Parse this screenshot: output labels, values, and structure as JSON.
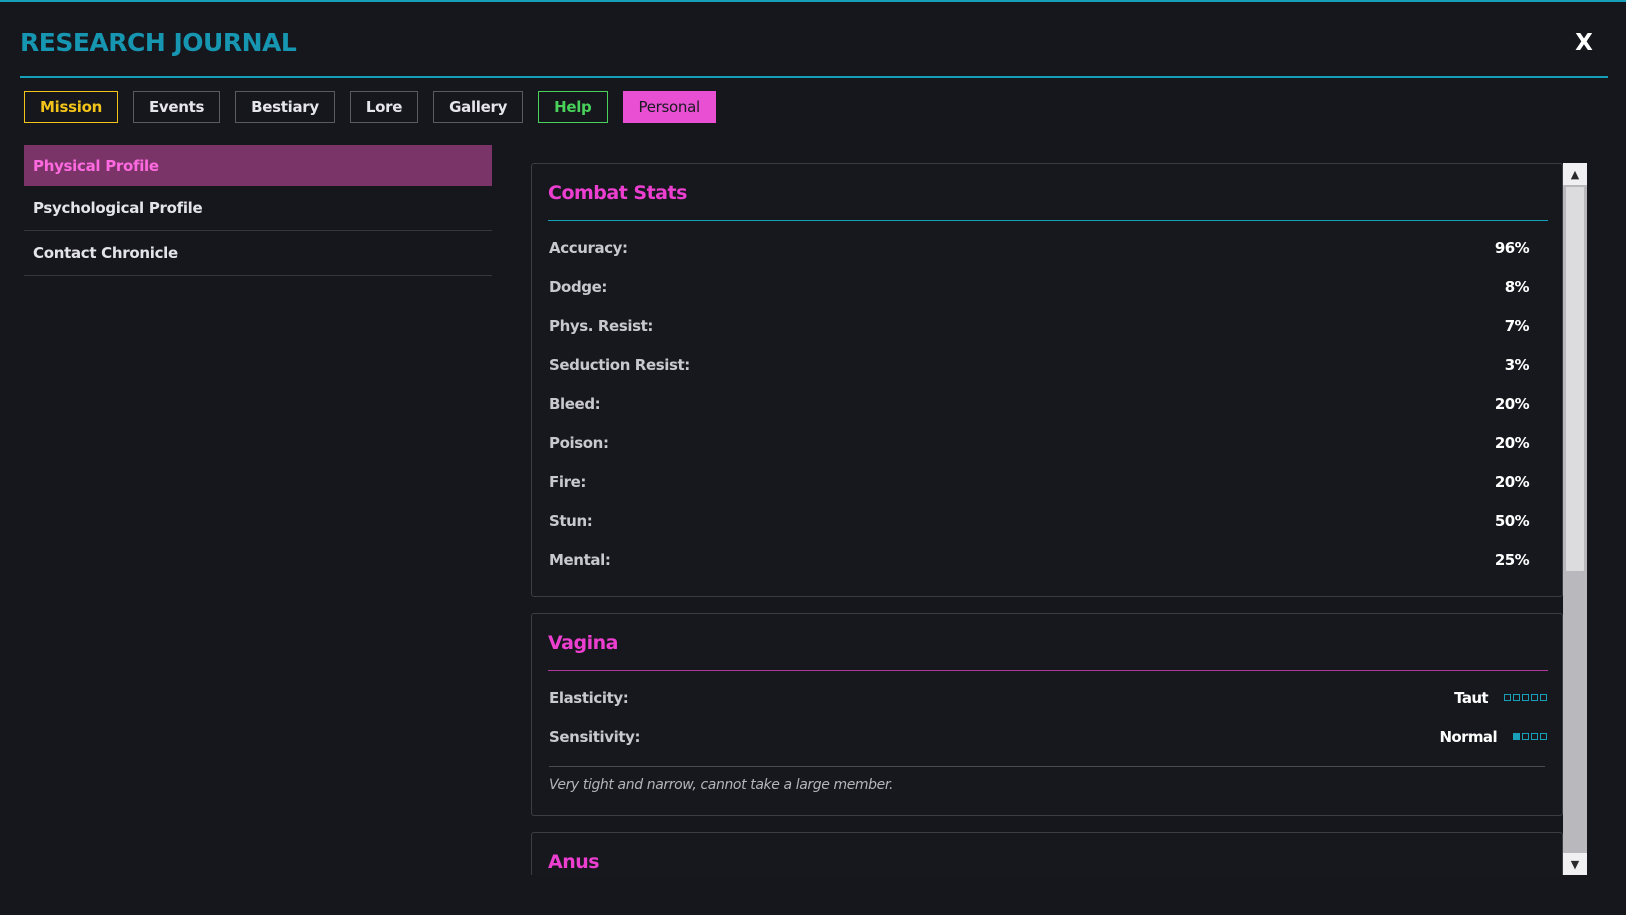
{
  "header": {
    "title": "RESEARCH JOURNAL",
    "close_label": "X"
  },
  "tabs": [
    {
      "label": "Mission",
      "color": "#f2c318"
    },
    {
      "label": "Events"
    },
    {
      "label": "Bestiary"
    },
    {
      "label": "Lore"
    },
    {
      "label": "Gallery"
    },
    {
      "label": "Help",
      "color": "#49d25a"
    },
    {
      "label": "Personal",
      "color": "#e84fd2",
      "active": true
    }
  ],
  "sidebar": {
    "items": [
      {
        "label": "Physical Profile",
        "active": true
      },
      {
        "label": "Psychological Profile"
      },
      {
        "label": "Contact Chronicle"
      }
    ]
  },
  "combat": {
    "title": "Combat Stats",
    "stats": [
      {
        "label": "Accuracy:",
        "value": "96%"
      },
      {
        "label": "Dodge:",
        "value": "8%"
      },
      {
        "label": "Phys. Resist:",
        "value": "7%"
      },
      {
        "label": "Seduction Resist:",
        "value": "3%"
      },
      {
        "label": "Bleed:",
        "value": "20%"
      },
      {
        "label": "Poison:",
        "value": "20%"
      },
      {
        "label": "Fire:",
        "value": "20%"
      },
      {
        "label": "Stun:",
        "value": "50%"
      },
      {
        "label": "Mental:",
        "value": "25%"
      }
    ]
  },
  "vagina": {
    "title": "Vagina",
    "attributes": [
      {
        "label": "Elasticity:",
        "value": "Taut",
        "level": 0,
        "max": 5
      },
      {
        "label": "Sensitivity:",
        "value": "Normal",
        "level": 1,
        "max": 4
      }
    ],
    "note": "Very tight and narrow, cannot take a large member."
  },
  "anus": {
    "title": "Anus"
  },
  "scrollbar": {
    "up_icon": "▲",
    "down_icon": "▼"
  },
  "colors": {
    "accent_cyan": "#14a0b8",
    "accent_pink": "#ec3fd0",
    "mission_yellow": "#f2c318",
    "help_green": "#49d25a"
  }
}
